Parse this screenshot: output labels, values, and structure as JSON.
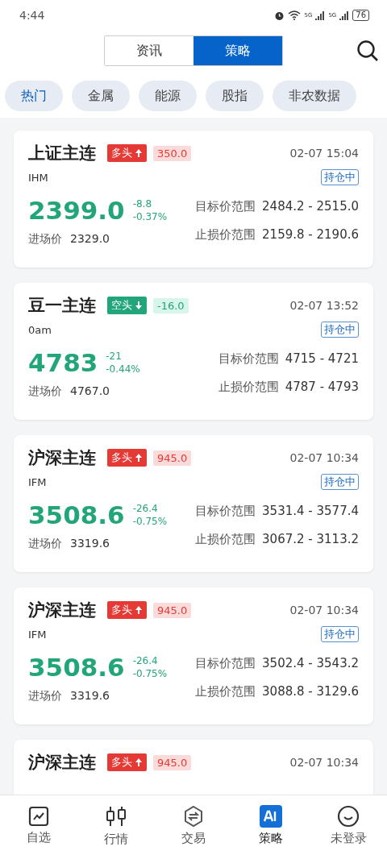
{
  "status_bar": {
    "time": "4:44",
    "network_1": "5G",
    "network_2": "5G",
    "battery": "76"
  },
  "header": {
    "segments": [
      {
        "label": "资讯",
        "selected": false
      },
      {
        "label": "策略",
        "selected": true
      }
    ]
  },
  "categories": [
    {
      "label": "热门",
      "selected": true
    },
    {
      "label": "金属",
      "selected": false
    },
    {
      "label": "能源",
      "selected": false
    },
    {
      "label": "股指",
      "selected": false
    },
    {
      "label": "非农数据",
      "selected": false
    }
  ],
  "strategies": [
    {
      "name": "上证主连",
      "kind": "long",
      "direction_label": "多头",
      "points": "350.0",
      "time": "02-07 15:04",
      "code": "IHM",
      "status": "持仓中",
      "price": "2399.0",
      "change": "-8.8",
      "change_pct": "-0.37%",
      "entry_label": "进场价",
      "entry": "2329.0",
      "target_label": "目标价范围",
      "target": "2484.2 - 2515.0",
      "stop_label": "止损价范围",
      "stop": "2159.8 - 2190.6"
    },
    {
      "name": "豆一主连",
      "kind": "short",
      "direction_label": "空头",
      "points": "-16.0",
      "time": "02-07 13:52",
      "code": "0am",
      "status": "持仓中",
      "price": "4783",
      "change": "-21",
      "change_pct": "-0.44%",
      "entry_label": "进场价",
      "entry": "4767.0",
      "target_label": "目标价范围",
      "target": "4715 - 4721",
      "stop_label": "止损价范围",
      "stop": "4787 - 4793"
    },
    {
      "name": "沪深主连",
      "kind": "long",
      "direction_label": "多头",
      "points": "945.0",
      "time": "02-07 10:34",
      "code": "IFM",
      "status": "持仓中",
      "price": "3508.6",
      "change": "-26.4",
      "change_pct": "-0.75%",
      "entry_label": "进场价",
      "entry": "3319.6",
      "target_label": "目标价范围",
      "target": "3531.4 - 3577.4",
      "stop_label": "止损价范围",
      "stop": "3067.2 - 3113.2"
    },
    {
      "name": "沪深主连",
      "kind": "long",
      "direction_label": "多头",
      "points": "945.0",
      "time": "02-07 10:34",
      "code": "IFM",
      "status": "持仓中",
      "price": "3508.6",
      "change": "-26.4",
      "change_pct": "-0.75%",
      "entry_label": "进场价",
      "entry": "3319.6",
      "target_label": "目标价范围",
      "target": "3502.4 - 3543.2",
      "stop_label": "止损价范围",
      "stop": "3088.8 - 3129.6"
    },
    {
      "name": "沪深主连",
      "kind": "long",
      "direction_label": "多头",
      "points": "945.0",
      "time": "02-07 10:34"
    }
  ],
  "tab_bar": [
    {
      "kind": "watchlist",
      "label": "自选",
      "selected": false
    },
    {
      "kind": "market",
      "label": "行情",
      "selected": false
    },
    {
      "kind": "trade",
      "label": "交易",
      "selected": false
    },
    {
      "kind": "ai",
      "label": "策略",
      "selected": true
    },
    {
      "kind": "account",
      "label": "未登录",
      "selected": false
    }
  ]
}
